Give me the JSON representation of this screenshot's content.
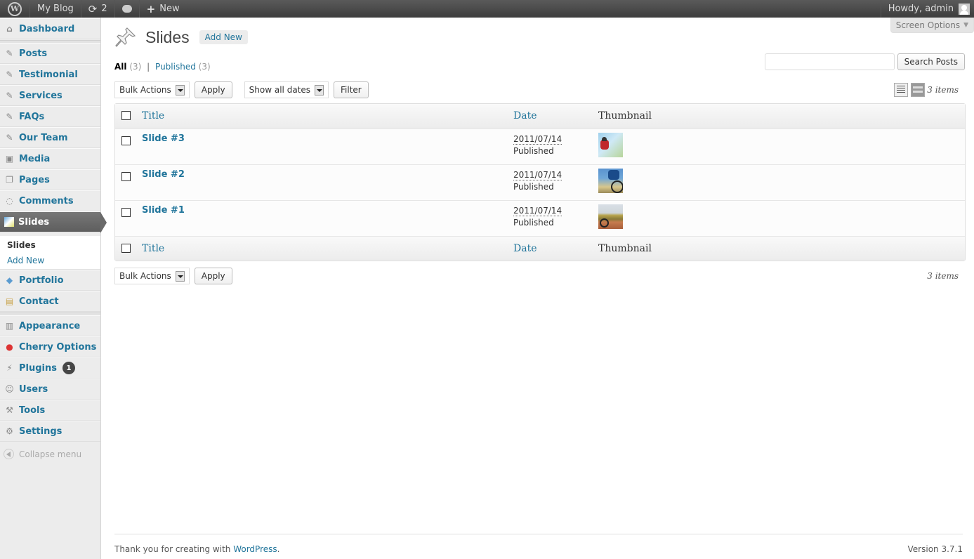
{
  "adminbar": {
    "site_name": "My Blog",
    "updates_count": "2",
    "new_label": "New",
    "greeting": "Howdy, admin"
  },
  "sidebar": {
    "items": [
      {
        "label": "Dashboard",
        "icon": "dashboard-icon"
      },
      {
        "label": "Posts",
        "icon": "pushpin-icon"
      },
      {
        "label": "Testimonial",
        "icon": "pushpin-icon"
      },
      {
        "label": "Services",
        "icon": "pushpin-icon"
      },
      {
        "label": "FAQs",
        "icon": "pushpin-icon"
      },
      {
        "label": "Our Team",
        "icon": "pushpin-icon"
      },
      {
        "label": "Media",
        "icon": "media-icon"
      },
      {
        "label": "Pages",
        "icon": "pages-icon"
      },
      {
        "label": "Comments",
        "icon": "comment-icon"
      },
      {
        "label": "Slides",
        "icon": "slides-icon"
      },
      {
        "label": "Portfolio",
        "icon": "portfolio-icon"
      },
      {
        "label": "Contact",
        "icon": "contact-icon"
      },
      {
        "label": "Appearance",
        "icon": "appearance-icon"
      },
      {
        "label": "Cherry Options",
        "icon": "cherry-icon"
      },
      {
        "label": "Plugins",
        "icon": "plugin-icon"
      },
      {
        "label": "Users",
        "icon": "users-icon"
      },
      {
        "label": "Tools",
        "icon": "tools-icon"
      },
      {
        "label": "Settings",
        "icon": "settings-icon"
      }
    ],
    "submenu": {
      "current": "Slides",
      "add_new": "Add New"
    },
    "plugins_badge": "1",
    "collapse_label": "Collapse menu"
  },
  "header": {
    "title": "Slides",
    "add_new": "Add New",
    "screen_options": "Screen Options"
  },
  "filters": {
    "all_label": "All",
    "all_count": "(3)",
    "separator": "|",
    "published_label": "Published",
    "published_count": "(3)"
  },
  "search": {
    "button": "Search Posts",
    "value": ""
  },
  "tablenav": {
    "bulk_actions": "Bulk Actions",
    "apply": "Apply",
    "dates": "Show all dates",
    "filter": "Filter",
    "items_count": "3 items"
  },
  "table": {
    "columns": {
      "title": "Title",
      "date": "Date",
      "thumbnail": "Thumbnail"
    },
    "rows": [
      {
        "title": "Slide #3",
        "date": "2011/07/14",
        "status": "Published"
      },
      {
        "title": "Slide #2",
        "date": "2011/07/14",
        "status": "Published"
      },
      {
        "title": "Slide #1",
        "date": "2011/07/14",
        "status": "Published"
      }
    ]
  },
  "footer": {
    "thanks_prefix": "Thank you for creating with ",
    "thanks_link": "WordPress",
    "thanks_suffix": ".",
    "version": "Version 3.7.1"
  },
  "colors": {
    "link": "#21759b",
    "adminbar": "#464646",
    "current_menu": "#6a6a6a"
  }
}
